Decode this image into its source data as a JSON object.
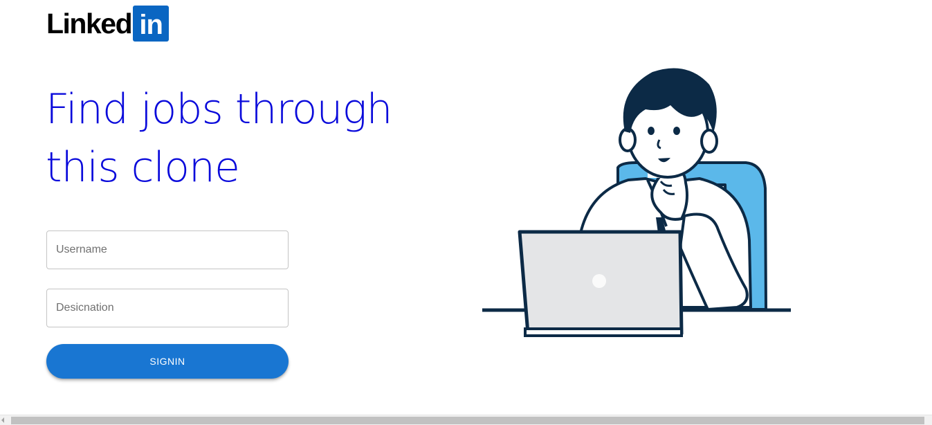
{
  "logo": {
    "wordmark": "Linked",
    "badge": "in",
    "brand_color": "#0a66c2"
  },
  "hero": {
    "headline_line1": "Find jobs through",
    "headline_line2": "this clone",
    "headline_color": "#0a0adb"
  },
  "form": {
    "username_placeholder": "Username",
    "designation_placeholder": "Desicnation",
    "signin_label": "SIGNIN",
    "button_color": "#1976d2"
  },
  "illustration": {
    "icon": "man-at-laptop-illustration"
  }
}
